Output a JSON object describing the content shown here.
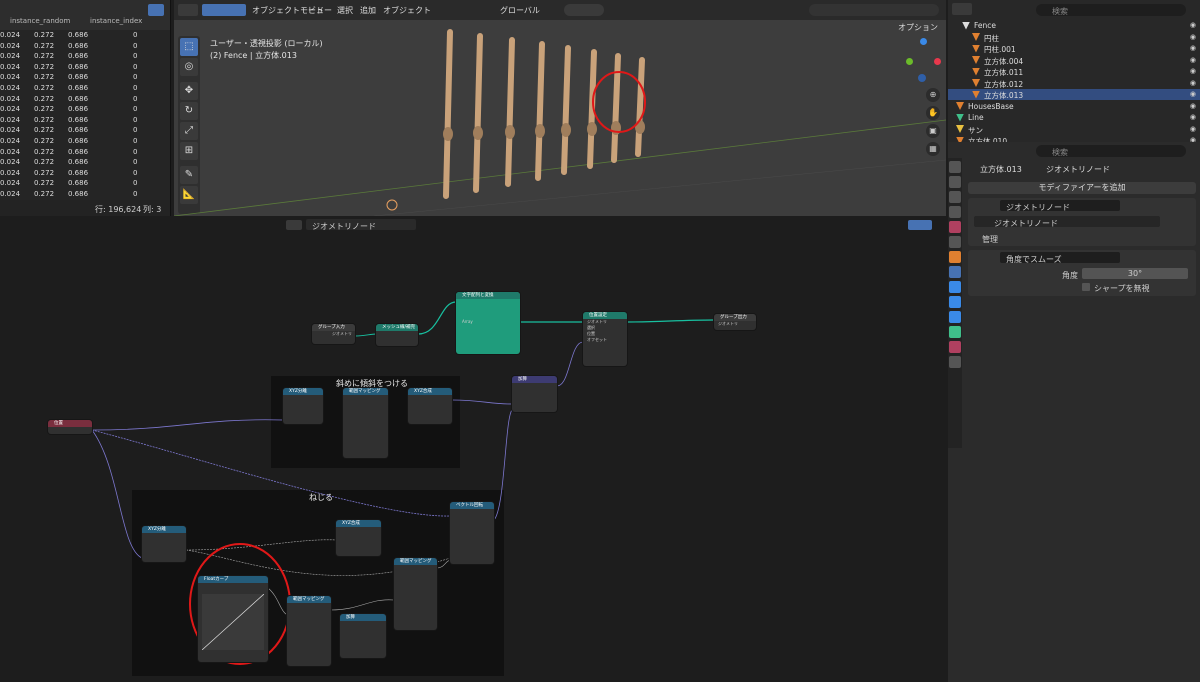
{
  "spreadsheet": {
    "columns": [
      "instance_random",
      "instance_index"
    ],
    "rows": [
      [
        "0.024",
        "0.272",
        "0.686",
        "0"
      ],
      [
        "0.024",
        "0.272",
        "0.686",
        "0"
      ],
      [
        "0.024",
        "0.272",
        "0.686",
        "0"
      ],
      [
        "0.024",
        "0.272",
        "0.686",
        "0"
      ],
      [
        "0.024",
        "0.272",
        "0.686",
        "0"
      ],
      [
        "0.024",
        "0.272",
        "0.686",
        "0"
      ],
      [
        "0.024",
        "0.272",
        "0.686",
        "0"
      ],
      [
        "0.024",
        "0.272",
        "0.686",
        "0"
      ],
      [
        "0.024",
        "0.272",
        "0.686",
        "0"
      ],
      [
        "0.024",
        "0.272",
        "0.686",
        "0"
      ],
      [
        "0.024",
        "0.272",
        "0.686",
        "0"
      ],
      [
        "0.024",
        "0.272",
        "0.686",
        "0"
      ],
      [
        "0.024",
        "0.272",
        "0.686",
        "0"
      ],
      [
        "0.024",
        "0.272",
        "0.686",
        "0"
      ],
      [
        "0.024",
        "0.272",
        "0.686",
        "0"
      ],
      [
        "0.024",
        "0.272",
        "0.686",
        "0"
      ]
    ],
    "footer_rows": "行: 196,624",
    "footer_cols": "列: 3"
  },
  "viewport": {
    "mode": "オブジェクトモード",
    "menu": [
      "ビュー",
      "選択",
      "追加",
      "オブジェクト"
    ],
    "transform": "グローバル",
    "options": "オプション",
    "info_line1": "ユーザー・透視投影 (ローカル)",
    "info_line2": "(2) Fence | 立方体.013"
  },
  "outliner": {
    "search_placeholder": "検索",
    "items": [
      {
        "label": "Fence",
        "selected": false
      },
      {
        "label": "円柱",
        "selected": false
      },
      {
        "label": "円柱.001",
        "selected": false
      },
      {
        "label": "立方体.004",
        "selected": false
      },
      {
        "label": "立方体.011",
        "selected": false
      },
      {
        "label": "立方体.012",
        "selected": false
      },
      {
        "label": "立方体.013",
        "selected": true
      },
      {
        "label": "HousesBase",
        "selected": false
      },
      {
        "label": "Line",
        "selected": false
      },
      {
        "label": "サン",
        "selected": false
      },
      {
        "label": "立方体.010",
        "selected": false
      }
    ]
  },
  "properties": {
    "search_placeholder": "検索",
    "object_name": "立方体.013",
    "modifier_tab": "ジオメトリノード",
    "add_modifier": "モディファイアーを追加",
    "modifier1_name": "ジオメトリノード",
    "node_group": "ジオメトリノード",
    "manage": "管理",
    "modifier2_name": "角度でスムーズ",
    "angle_label": "角度",
    "angle_value": "30°",
    "ignore_sharp": "シャープを無視"
  },
  "node_editor": {
    "header_label": "ジオメトリノード",
    "frame1_label": "斜めに傾斜をつける",
    "frame2_label": "ねじる",
    "nodes": {
      "group_input": "グループ入力",
      "group_input_socket": "ジオメトリ",
      "mesh_to_curve": "メッシュ線/補完",
      "instance": "文字配列と変換",
      "instance_socket": "Array",
      "set_position": "位置設定",
      "set_position_geom": "ジオメトリ",
      "set_position_sel": "選択",
      "set_position_pos": "位置",
      "set_position_offset": "オフセット",
      "group_output": "グループ出力",
      "group_output_socket": "ジオメトリ",
      "position": "位置",
      "position_out": "位置",
      "separate_xyz_1": "XYZ分離",
      "map_range_1": "範囲マッピング",
      "combine_xyz_1": "XYZ合成",
      "vector_math": "加算",
      "vector_rotate": "ベクトル回転",
      "separate_xyz_2": "XYZ分離",
      "combine_xyz_2": "XYZ合成",
      "float_curve": "Floatカーブ",
      "map_range_2": "範囲マッピング",
      "map_range_3": "範囲マッピング",
      "math": "加算",
      "float_label": "Float",
      "linear_label": "リニア",
      "clamp_label": "範囲制限",
      "vector_label": "ベクトル",
      "value_label": "結果"
    }
  },
  "colors": {
    "accent": "#4772b3",
    "teal_node": "#1f9c7c",
    "pink_node": "#c2406a",
    "annotation": "#e01818"
  }
}
